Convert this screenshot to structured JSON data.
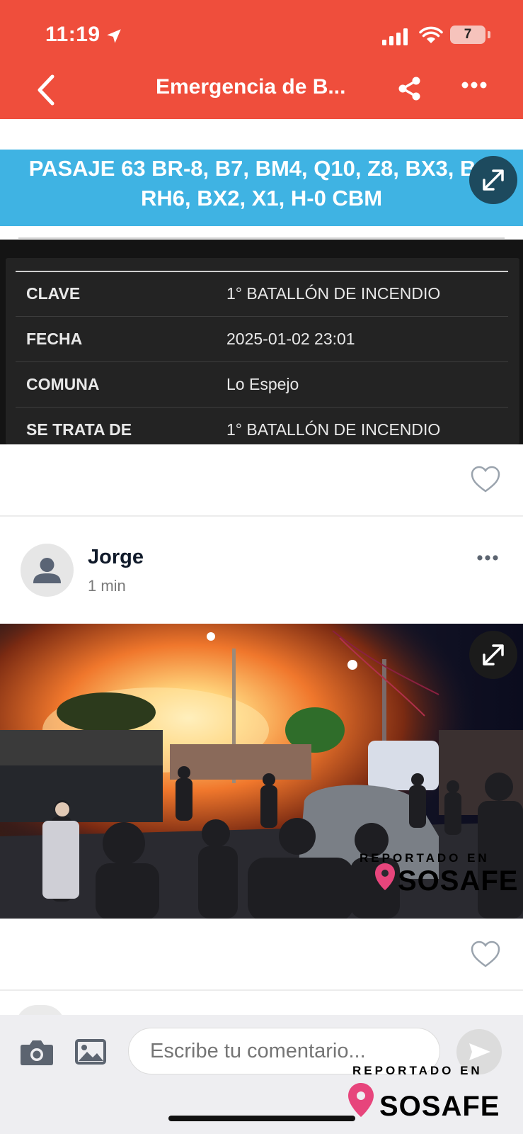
{
  "status_bar": {
    "time": "11:19",
    "battery": "7"
  },
  "header": {
    "title": "Emergencia de B..."
  },
  "banner": {
    "text": "PASAJE 63 BR-8, B7, BM4, Q10, Z8, BX3, B1,\nRH6, BX2, X1, H-0 CBM"
  },
  "details": [
    {
      "key": "CLAVE",
      "value": "1° BATALLÓN DE INCENDIO"
    },
    {
      "key": "FECHA",
      "value": "2025-01-02 23:01"
    },
    {
      "key": "COMUNA",
      "value": "Lo Espejo"
    },
    {
      "key": "SE TRATA DE",
      "value": "1° BATALLÓN DE INCENDIO"
    }
  ],
  "post": {
    "author": "Jorge",
    "time": "1 min"
  },
  "watermark": {
    "reported": "REPORTADO EN",
    "brand": "SOSAFE"
  },
  "comment": {
    "placeholder": "Escribe tu comentario..."
  },
  "colors": {
    "header": "#ef4e3c",
    "banner": "#3fb3e3",
    "brand": "#e7457c"
  }
}
